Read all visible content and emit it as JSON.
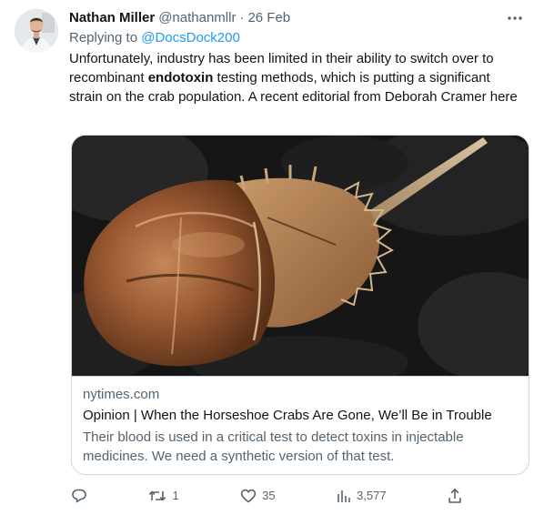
{
  "tweet": {
    "author": {
      "name": "Nathan Miller",
      "handle": "@nathanmllr"
    },
    "separator": "·",
    "date": "26 Feb",
    "reply": {
      "prefix": "Replying to ",
      "mention": "@DocsDock200"
    },
    "text": {
      "before": "Unfortunately, industry has been limited in their ability to switch over to recombinant ",
      "bold": "endotoxin",
      "after": " testing methods, which is putting a significant strain on the crab population. A recent editorial from Deborah Cramer here"
    }
  },
  "card": {
    "image_subject": "horseshoe crab on dark stones",
    "domain": "nytimes.com",
    "title": "Opinion | When the Horseshoe Crabs Are Gone, We’ll Be in Trouble",
    "description": "Their blood is used in a critical test to detect toxins in injectable medicines. We need a synthetic version of that test."
  },
  "actions": {
    "reply": {
      "icon": "reply-icon"
    },
    "retweet": {
      "icon": "retweet-icon",
      "count": "1"
    },
    "like": {
      "icon": "heart-icon",
      "count": "35"
    },
    "views": {
      "icon": "views-icon",
      "count": "3,577"
    },
    "share": {
      "icon": "share-icon"
    }
  },
  "colors": {
    "text": "#0f1419",
    "secondary": "#536471",
    "link": "#1d9bf0",
    "border": "#cfd9de"
  }
}
